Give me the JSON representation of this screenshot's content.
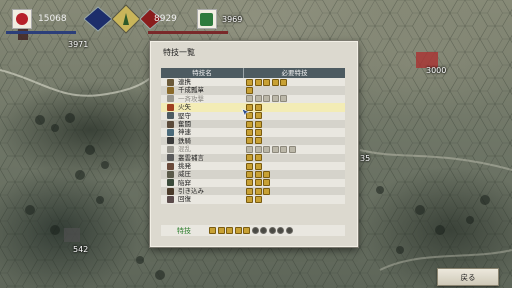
{
  "hud": {
    "left_value": "15068",
    "right_value": "8929",
    "right_sub_value": "3969",
    "colors": {
      "left_bar": "#1d2e6b",
      "right_bar": "#8a1d1d",
      "left_crest": "#b6202a",
      "right_crest": "#2e7a3d"
    }
  },
  "map_labels": {
    "unit_a": "3971",
    "unit_b": "3000",
    "unit_c": "542",
    "unit_d": "35"
  },
  "dialog": {
    "title": "特技一覧",
    "col_name": "特技名",
    "col_req": "必要特技",
    "rows": [
      {
        "name": "連携",
        "pips": 5,
        "grey": 0,
        "dim": false,
        "sel": false
      },
      {
        "name": "千成瓢箪",
        "pips": 1,
        "grey": 0,
        "dim": false,
        "sel": false
      },
      {
        "name": "一斉攻撃",
        "pips": 5,
        "grey": 0,
        "dim": true,
        "sel": false
      },
      {
        "name": "火矢",
        "pips": 2,
        "grey": 0,
        "dim": false,
        "sel": true
      },
      {
        "name": "堅守",
        "pips": 2,
        "grey": 0,
        "dim": false,
        "sel": false
      },
      {
        "name": "奮闘",
        "pips": 2,
        "grey": 0,
        "dim": false,
        "sel": false
      },
      {
        "name": "神速",
        "pips": 2,
        "grey": 0,
        "dim": false,
        "sel": false
      },
      {
        "name": "鉄騎",
        "pips": 2,
        "grey": 0,
        "dim": false,
        "sel": false
      },
      {
        "name": "混乱",
        "pips": 6,
        "grey": 0,
        "dim": true,
        "sel": false
      },
      {
        "name": "叢雲補言",
        "pips": 2,
        "grey": 0,
        "dim": false,
        "sel": false
      },
      {
        "name": "挑発",
        "pips": 2,
        "grey": 0,
        "dim": false,
        "sel": false
      },
      {
        "name": "威圧",
        "pips": 3,
        "grey": 0,
        "dim": false,
        "sel": false
      },
      {
        "name": "陥穽",
        "pips": 3,
        "grey": 0,
        "dim": false,
        "sel": false
      },
      {
        "name": "引き込み",
        "pips": 3,
        "grey": 0,
        "dim": false,
        "sel": false
      },
      {
        "name": "回復",
        "pips": 2,
        "grey": 0,
        "dim": false,
        "sel": false
      }
    ],
    "footer_label": "特技",
    "footer_pips": 5,
    "footer_grey": 5
  },
  "back_label": "戻る"
}
